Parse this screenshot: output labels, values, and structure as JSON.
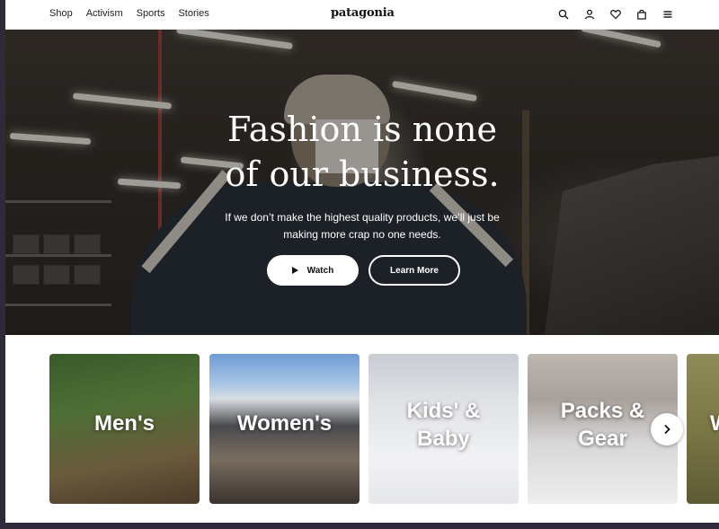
{
  "header": {
    "nav": [
      "Shop",
      "Activism",
      "Sports",
      "Stories"
    ],
    "logo": "patagonia",
    "icons": [
      "search-icon",
      "account-icon",
      "heart-icon",
      "bag-icon",
      "menu-icon"
    ]
  },
  "hero": {
    "headline_line1": "Fashion is none",
    "headline_line2": "of our business.",
    "subline_line1": "If we don’t make the highest quality products, we’ll just be",
    "subline_line2": "making more crap no one needs.",
    "watch_label": "Watch",
    "learn_more_label": "Learn More"
  },
  "categories": {
    "mens": "Men's",
    "womens": "Women's",
    "kids_line1": "Kids' &",
    "kids_line2": "Baby",
    "packs_line1": "Packs &",
    "packs_line2": "Gear",
    "next_partial": "W"
  },
  "colors": {
    "accent": "#ffffff",
    "text": "#1c1c1c",
    "frame": "#2e2a3a"
  }
}
